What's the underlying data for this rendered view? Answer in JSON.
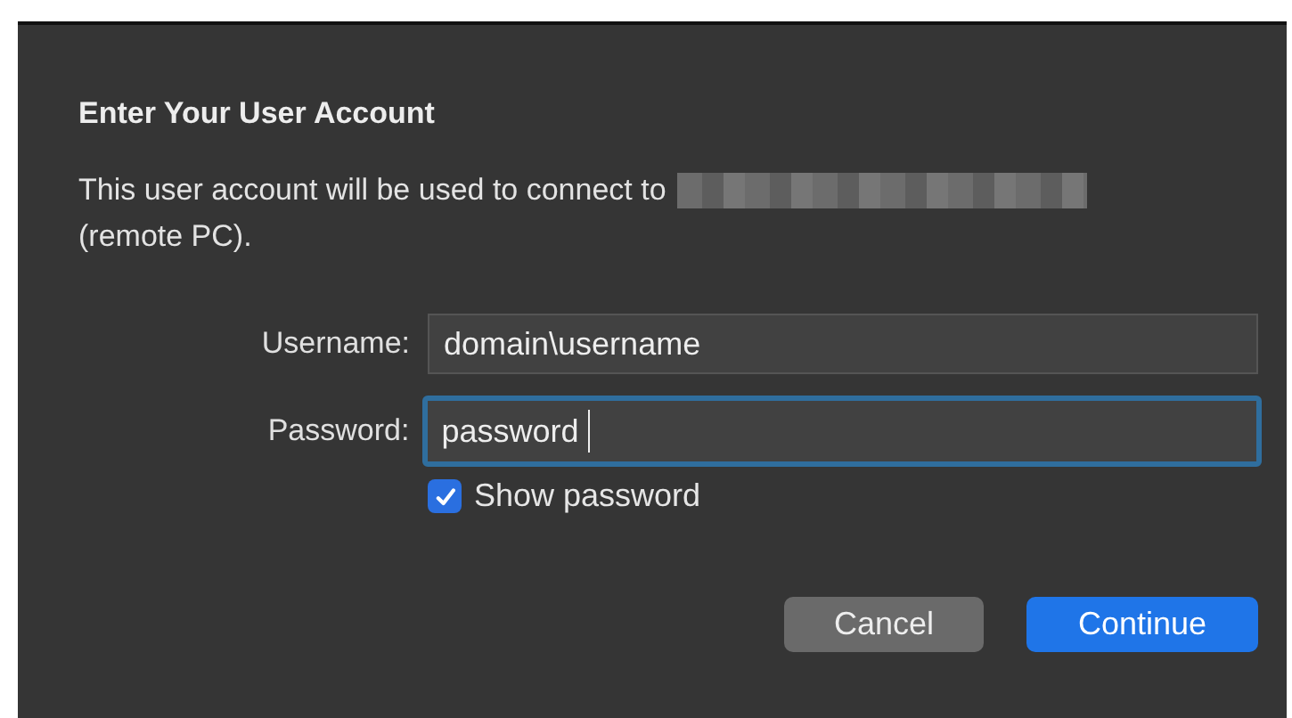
{
  "dialog": {
    "title": "Enter Your User Account",
    "description": {
      "before_redaction": "This user account will be used to connect to",
      "redacted": true,
      "after_redaction": "(remote PC)."
    },
    "fields": [
      {
        "label": "Username:",
        "value": "domain\\username",
        "focused": false
      },
      {
        "label": "Password:",
        "value": "password",
        "focused": true
      }
    ],
    "show_password": {
      "label": "Show password",
      "checked": true
    },
    "buttons": [
      {
        "label": "Cancel",
        "kind": "secondary"
      },
      {
        "label": "Continue",
        "kind": "primary"
      }
    ]
  }
}
